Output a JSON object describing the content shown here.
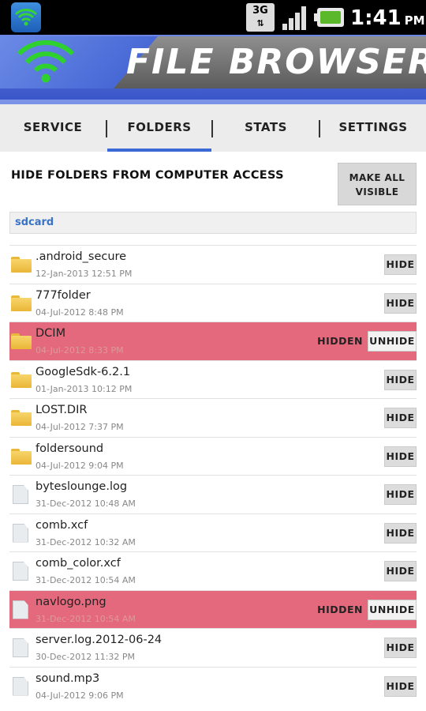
{
  "status_bar": {
    "network": "3G",
    "time": "1:41",
    "ampm": "PM"
  },
  "banner": {
    "title": "FILE BROWSER"
  },
  "tabs": [
    {
      "label": "SERVICE"
    },
    {
      "label": "FOLDERS",
      "active": true
    },
    {
      "label": "STATS"
    },
    {
      "label": "SETTINGS"
    }
  ],
  "section": {
    "title": "HIDE FOLDERS FROM COMPUTER ACCESS",
    "make_all_visible_line1": "MAKE ALL",
    "make_all_visible_line2": "VISIBLE"
  },
  "path": "sdcard",
  "colors": {
    "accent": "#3b6ad6",
    "hidden_row": "#e5697c",
    "path_text": "#3a73c4"
  },
  "files": [
    {
      "name": ".android_secure",
      "date": "12-Jan-2013 12:51 PM",
      "type": "folder-icon",
      "hidden": false,
      "button": "HIDE"
    },
    {
      "name": "777folder",
      "date": "04-Jul-2012 8:48 PM",
      "type": "folder-icon",
      "hidden": false,
      "button": "HIDE"
    },
    {
      "name": "DCIM",
      "date": "04-Jul-2012 8:33 PM",
      "type": "folder-icon",
      "hidden": true,
      "status": "HIDDEN",
      "button": "UNHIDE"
    },
    {
      "name": "GoogleSdk-6.2.1",
      "date": "01-Jan-2013 10:12 PM",
      "type": "folder-icon",
      "hidden": false,
      "button": "HIDE"
    },
    {
      "name": "LOST.DIR",
      "date": "04-Jul-2012 7:37 PM",
      "type": "folder-icon",
      "hidden": false,
      "button": "HIDE"
    },
    {
      "name": "foldersound",
      "date": "04-Jul-2012 9:04 PM",
      "type": "folder-icon",
      "hidden": false,
      "button": "HIDE"
    },
    {
      "name": "byteslounge.log",
      "date": "31-Dec-2012 10:48 AM",
      "type": "file-icon",
      "hidden": false,
      "button": "HIDE"
    },
    {
      "name": "comb.xcf",
      "date": "31-Dec-2012 10:32 AM",
      "type": "file-icon",
      "hidden": false,
      "button": "HIDE"
    },
    {
      "name": "comb_color.xcf",
      "date": "31-Dec-2012 10:54 AM",
      "type": "file-icon",
      "hidden": false,
      "button": "HIDE"
    },
    {
      "name": "navlogo.png",
      "date": "31-Dec-2012 10:54 AM",
      "type": "file-icon",
      "hidden": true,
      "status": "HIDDEN",
      "button": "UNHIDE"
    },
    {
      "name": "server.log.2012-06-24",
      "date": "30-Dec-2012 11:32 PM",
      "type": "file-icon",
      "hidden": false,
      "button": "HIDE"
    },
    {
      "name": "sound.mp3",
      "date": "04-Jul-2012 9:06 PM",
      "type": "file-icon",
      "hidden": false,
      "button": "HIDE"
    }
  ]
}
